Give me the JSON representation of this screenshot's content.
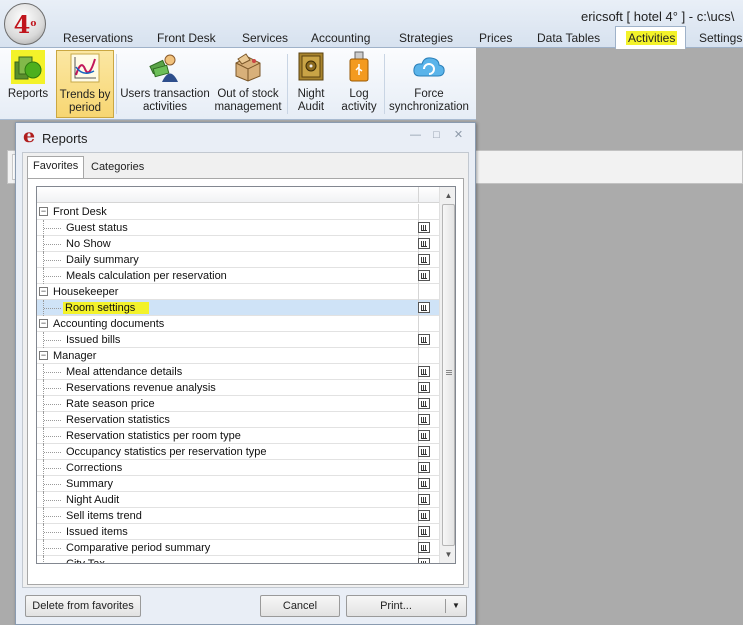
{
  "window": {
    "title": "ericsoft [ hotel 4° ] - c:\\ucs\\"
  },
  "menu_tabs": [
    {
      "label": "Reservations"
    },
    {
      "label": "Front Desk"
    },
    {
      "label": "Services"
    },
    {
      "label": "Accounting"
    },
    {
      "label": "Strategies"
    },
    {
      "label": "Prices"
    },
    {
      "label": "Data Tables"
    },
    {
      "label": "Activities"
    },
    {
      "label": "Settings"
    }
  ],
  "ribbon": {
    "buttons": [
      {
        "line1": "Reports",
        "line2": "",
        "icon": "reports-icon"
      },
      {
        "line1": "Trends by",
        "line2": "period",
        "icon": "trend-chart-icon"
      },
      {
        "line1": "Users transaction",
        "line2": "activities",
        "icon": "user-money-icon"
      },
      {
        "line1": "Out of stock",
        "line2": "management",
        "icon": "package-icon"
      },
      {
        "line1": "Night",
        "line2": "Audit",
        "icon": "safe-icon"
      },
      {
        "line1": "Log",
        "line2": "activity",
        "icon": "usb-drive-icon"
      },
      {
        "line1": "Force",
        "line2": "synchronization",
        "icon": "cloud-sync-icon"
      }
    ]
  },
  "dialog": {
    "title": "Reports",
    "tabs": [
      {
        "label": "Favorites"
      },
      {
        "label": "Categories"
      }
    ],
    "tree": [
      {
        "label": "Front Desk",
        "group": true
      },
      {
        "label": "Guest status",
        "group": false
      },
      {
        "label": "No Show",
        "group": false
      },
      {
        "label": "Daily summary",
        "group": false
      },
      {
        "label": "Meals calculation per reservation",
        "group": false
      },
      {
        "label": "Housekeeper",
        "group": true
      },
      {
        "label": "Room settings",
        "group": false,
        "selected": true
      },
      {
        "label": "Accounting documents",
        "group": true
      },
      {
        "label": "Issued bills",
        "group": false
      },
      {
        "label": "Manager",
        "group": true
      },
      {
        "label": "Meal attendance details",
        "group": false
      },
      {
        "label": "Reservations revenue analysis",
        "group": false
      },
      {
        "label": "Rate season price",
        "group": false
      },
      {
        "label": "Reservation statistics",
        "group": false
      },
      {
        "label": "Reservation statistics per room type",
        "group": false
      },
      {
        "label": "Occupancy statistics  per  reservation type",
        "group": false
      },
      {
        "label": "Corrections",
        "group": false
      },
      {
        "label": "Summary",
        "group": false
      },
      {
        "label": "Night Audit",
        "group": false
      },
      {
        "label": "Sell items trend",
        "group": false
      },
      {
        "label": "Issued items",
        "group": false
      },
      {
        "label": "Comparative period summary",
        "group": false
      },
      {
        "label": "City Tax",
        "group": false
      }
    ],
    "buttons": {
      "delete": "Delete from favorites",
      "cancel": "Cancel",
      "print": "Print..."
    }
  },
  "colors": {
    "highlight": "#f3f22a",
    "selected_row": "#cfe3f7",
    "ribbon_pressed": "#f7d672"
  }
}
